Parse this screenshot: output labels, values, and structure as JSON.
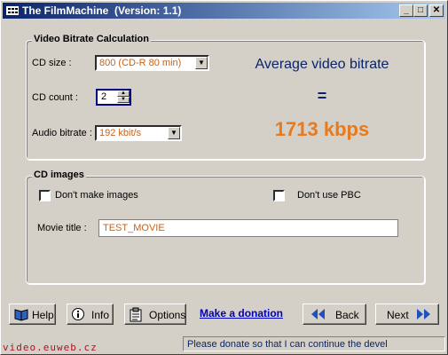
{
  "window": {
    "title": "The FilmMachine  (Version: 1.1)",
    "controls": [
      "_",
      "□",
      "✕"
    ]
  },
  "bitrate_calc": {
    "group_title": "Video Bitrate Calculation",
    "cd_size_label": "CD size :",
    "cd_size_value": "800 (CD-R 80 min)",
    "cd_count_label": "CD count :",
    "cd_count_value": "2",
    "audio_bitrate_label": "Audio bitrate :",
    "audio_bitrate_value": "192 kbit/s",
    "result_title": "Average video bitrate",
    "result_eq": "=",
    "result_value": "1713 kbps"
  },
  "cd_images": {
    "group_title": "CD images",
    "dont_make_images": "Don't make images",
    "dont_use_pbc": "Don't use PBC",
    "movie_title_label": "Movie title :",
    "movie_title_value": "TEST_MOVIE"
  },
  "buttons": {
    "help": "Help",
    "info": "Info",
    "options": "Options",
    "donation": "Make a donation",
    "back": "Back",
    "next": "Next"
  },
  "status": {
    "text": "Please donate so that I can continue the devel"
  },
  "watermark": "video.euweb.cz",
  "colors": {
    "accent_blue": "#0a246a",
    "value_orange": "#e87a1e",
    "link_blue": "#0000c0"
  }
}
